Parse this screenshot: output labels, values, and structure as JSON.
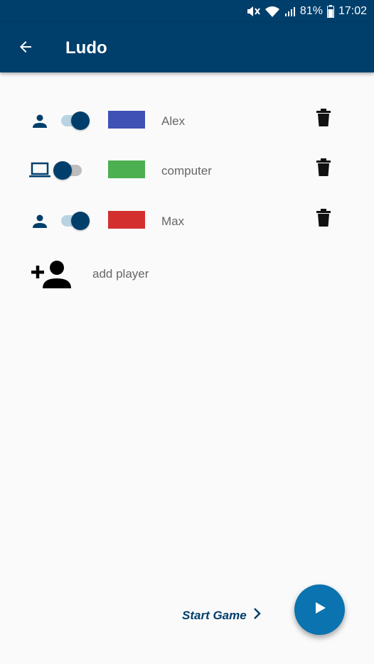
{
  "status_bar": {
    "battery_percent": "81%",
    "time": "17:02",
    "icons": [
      "mute-icon",
      "wifi-icon",
      "signal-icon",
      "battery-icon"
    ]
  },
  "app_bar": {
    "title": "Ludo",
    "back_icon": "arrow-back-icon"
  },
  "players": [
    {
      "type_icon": "person-icon",
      "enabled": true,
      "color": "#3f51b5",
      "name": "Alex",
      "delete_icon": "trash-icon"
    },
    {
      "type_icon": "laptop-icon",
      "enabled": false,
      "color": "#4caf50",
      "name": "computer",
      "delete_icon": "trash-icon"
    },
    {
      "type_icon": "person-icon",
      "enabled": true,
      "color": "#d32f2f",
      "name": "Max",
      "delete_icon": "trash-icon"
    }
  ],
  "add_player": {
    "label": "add player",
    "icon": "person-add-icon"
  },
  "footer": {
    "start_label": "Start Game",
    "start_icon": "chevron-right-icon",
    "fab_icon": "play-icon"
  },
  "colors": {
    "primary": "#003f6b",
    "fab": "#0a73b0",
    "background": "#fafafa"
  }
}
